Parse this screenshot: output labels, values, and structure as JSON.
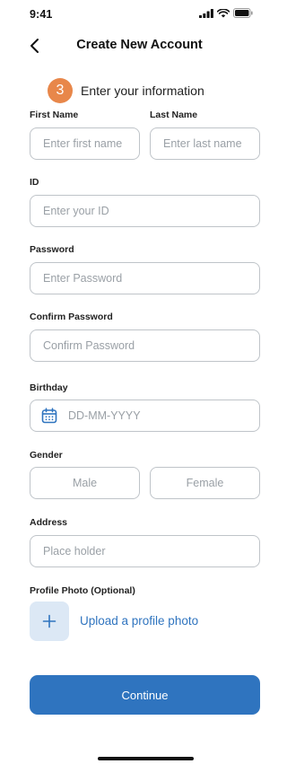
{
  "status_bar": {
    "time": "9:41"
  },
  "header": {
    "title": "Create New Account"
  },
  "step": {
    "number": "3",
    "text": "Enter your information"
  },
  "form": {
    "first_name": {
      "label": "First Name",
      "placeholder": "Enter first name"
    },
    "last_name": {
      "label": "Last Name",
      "placeholder": "Enter last name"
    },
    "id": {
      "label": "ID",
      "placeholder": "Enter your ID"
    },
    "password": {
      "label": "Password",
      "placeholder": "Enter Password"
    },
    "confirm_password": {
      "label": "Confirm Password",
      "placeholder": "Confirm Password"
    },
    "birthday": {
      "label": "Birthday",
      "placeholder": "DD-MM-YYYY"
    },
    "gender": {
      "label": "Gender",
      "options": [
        "Male",
        "Female"
      ]
    },
    "address": {
      "label": "Address",
      "placeholder": "Place holder"
    },
    "profile_photo": {
      "label": "Profile Photo (Optional)",
      "upload_text": "Upload a profile photo"
    }
  },
  "continue_label": "Continue",
  "colors": {
    "accent": "#2F74BF",
    "step_badge": "#E8874A",
    "upload_bg": "#DCE8F5"
  },
  "icons": [
    "signal-icon",
    "wifi-icon",
    "battery-icon",
    "back-arrow-icon",
    "calendar-icon",
    "plus-icon"
  ]
}
